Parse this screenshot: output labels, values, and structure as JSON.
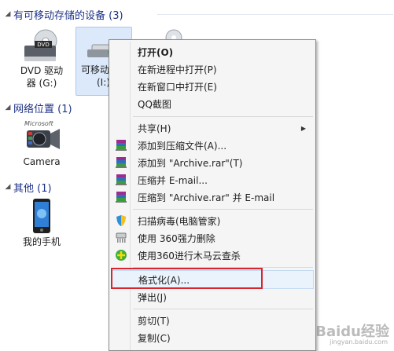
{
  "sections": {
    "removable": {
      "title": "有可移动存储的设备 (3)"
    },
    "network": {
      "title": "网络位置 (1)"
    },
    "other": {
      "title": "其他 (1)"
    }
  },
  "items": {
    "dvd": {
      "line1": "DVD 驱动",
      "line2": "器 (G:)"
    },
    "removable": {
      "line1": "可移动",
      "line2": "(I:)"
    },
    "camera": {
      "label": "Camera"
    },
    "phone": {
      "label": "我的手机"
    }
  },
  "menu": {
    "open": "打开(O)",
    "open_new_process": "在新进程中打开(P)",
    "open_new_window": "在新窗口中打开(E)",
    "qq_screenshot": "QQ截图",
    "share": "共享(H)",
    "add_to_archive": "添加到压缩文件(A)...",
    "add_to_archive_rar": "添加到 \"Archive.rar\"(T)",
    "compress_email": "压缩并 E-mail...",
    "compress_rar_email": "压缩到 \"Archive.rar\" 并 E-mail",
    "scan_virus": "扫描病毒(电脑管家)",
    "force_delete": "使用 360强力删除",
    "trojan_scan": "使用360进行木马云查杀",
    "format": "格式化(A)...",
    "eject": "弹出(J)",
    "cut": "剪切(T)",
    "copy": "复制(C)"
  },
  "watermark": {
    "brand": "Baidu经验",
    "url": "jingyan.baidu.com"
  },
  "colors": {
    "menu_bg": "#f5f5f5",
    "highlight_box": "#d7262b",
    "header_text": "#1e3287"
  }
}
